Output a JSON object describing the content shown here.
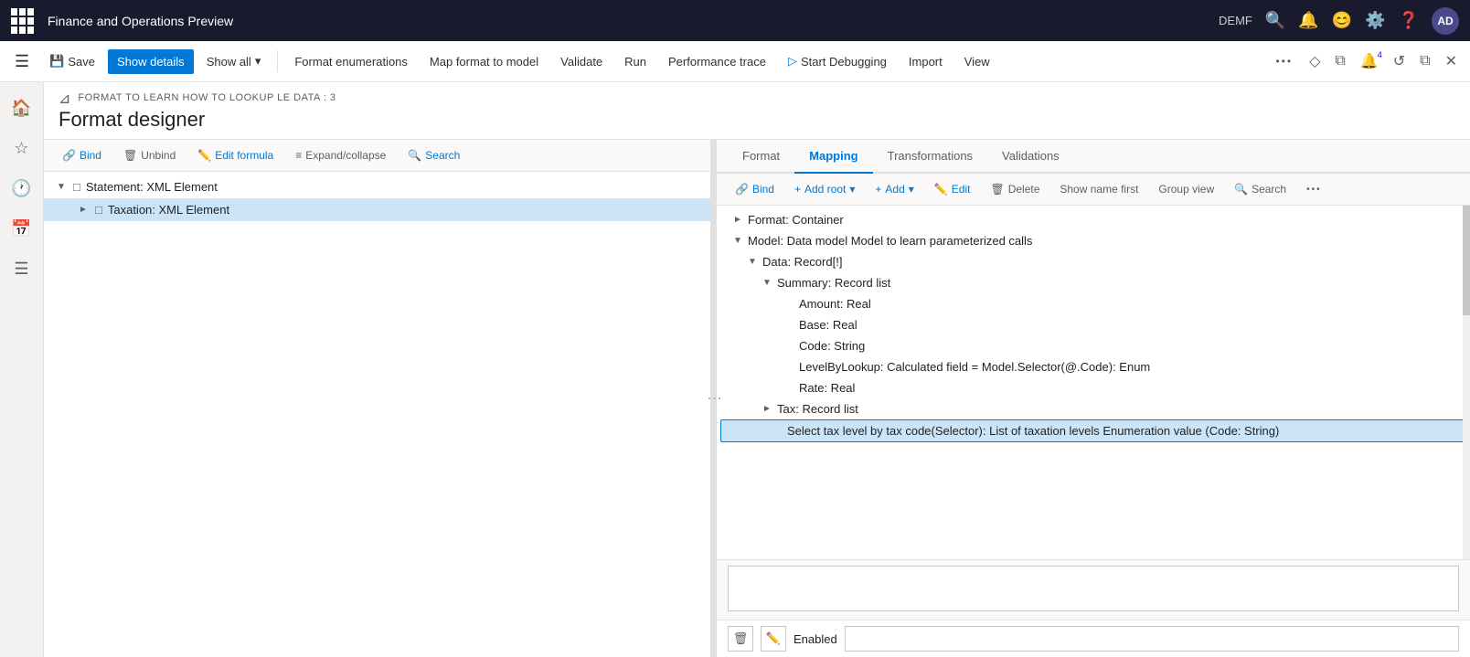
{
  "titlebar": {
    "app_name": "Finance and Operations Preview",
    "user_code": "DEMF",
    "user_initials": "AD"
  },
  "toolbar": {
    "save_label": "Save",
    "show_details_label": "Show details",
    "show_all_label": "Show all",
    "format_enumerations_label": "Format enumerations",
    "map_format_label": "Map format to model",
    "validate_label": "Validate",
    "run_label": "Run",
    "performance_trace_label": "Performance trace",
    "start_debugging_label": "Start Debugging",
    "import_label": "Import",
    "view_label": "View"
  },
  "page": {
    "breadcrumb": "FORMAT TO LEARN HOW TO LOOKUP LE DATA : 3",
    "title": "Format designer"
  },
  "left_panel": {
    "bind_label": "Bind",
    "unbind_label": "Unbind",
    "edit_formula_label": "Edit formula",
    "expand_collapse_label": "Expand/collapse",
    "search_label": "Search",
    "tree_items": [
      {
        "label": "Statement: XML Element",
        "indent": 0,
        "chevron": "▼",
        "expanded": true
      },
      {
        "label": "Taxation: XML Element",
        "indent": 1,
        "chevron": "►",
        "selected": true
      }
    ]
  },
  "right_panel": {
    "tabs": [
      {
        "label": "Format",
        "active": false
      },
      {
        "label": "Mapping",
        "active": true
      },
      {
        "label": "Transformations",
        "active": false
      },
      {
        "label": "Validations",
        "active": false
      }
    ],
    "toolbar": {
      "bind_label": "Bind",
      "add_root_label": "Add root",
      "add_label": "Add",
      "edit_label": "Edit",
      "delete_label": "Delete",
      "show_name_first_label": "Show name first",
      "group_view_label": "Group view",
      "search_label": "Search"
    },
    "mapping_items": [
      {
        "label": "Format: Container",
        "indent": 0,
        "chevron": "►",
        "level": 1
      },
      {
        "label": "Model: Data model Model to learn parameterized calls",
        "indent": 0,
        "chevron": "▼",
        "level": 1
      },
      {
        "label": "Data: Record[!]",
        "indent": 0,
        "chevron": "▼",
        "level": 2
      },
      {
        "label": "Summary: Record list",
        "indent": 0,
        "chevron": "▼",
        "level": 3
      },
      {
        "label": "Amount: Real",
        "indent": 0,
        "chevron": "",
        "level": 4
      },
      {
        "label": "Base: Real",
        "indent": 0,
        "chevron": "",
        "level": 4
      },
      {
        "label": "Code: String",
        "indent": 0,
        "chevron": "",
        "level": 4
      },
      {
        "label": "LevelByLookup: Calculated field = Model.Selector(@.Code): Enum",
        "indent": 0,
        "chevron": "",
        "level": 4
      },
      {
        "label": "Rate: Real",
        "indent": 0,
        "chevron": "",
        "level": 4
      },
      {
        "label": "Tax: Record list",
        "indent": 0,
        "chevron": "►",
        "level": 3
      }
    ],
    "selected_formula": "Select tax level by tax code(Selector): List of taxation levels Enumeration value (Code: String)",
    "formula_value": "",
    "enabled_label": "Enabled",
    "enabled_value": ""
  }
}
